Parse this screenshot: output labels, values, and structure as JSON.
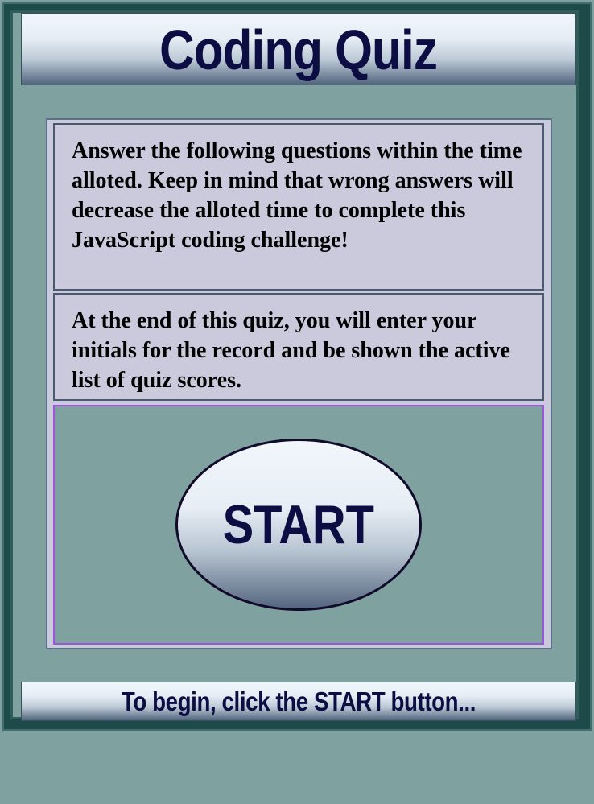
{
  "header": {
    "title": "Coding Quiz"
  },
  "intro": {
    "instructions": "Answer the following questions within the time alloted. Keep in mind that wrong answers will decrease the alloted time to complete this JavaScript coding challenge!",
    "records_note": "At the end of this quiz, you will enter your initials for the record and be shown the active list of quiz scores."
  },
  "start": {
    "label": "START"
  },
  "footer": {
    "prompt": "To begin, click the START button..."
  },
  "colors": {
    "page_background": "#7fa19f",
    "frame": "#1f4a4a",
    "card_background": "#cbcadc",
    "title_text": "#0c0d42",
    "start_area_border": "#9b57d8"
  }
}
